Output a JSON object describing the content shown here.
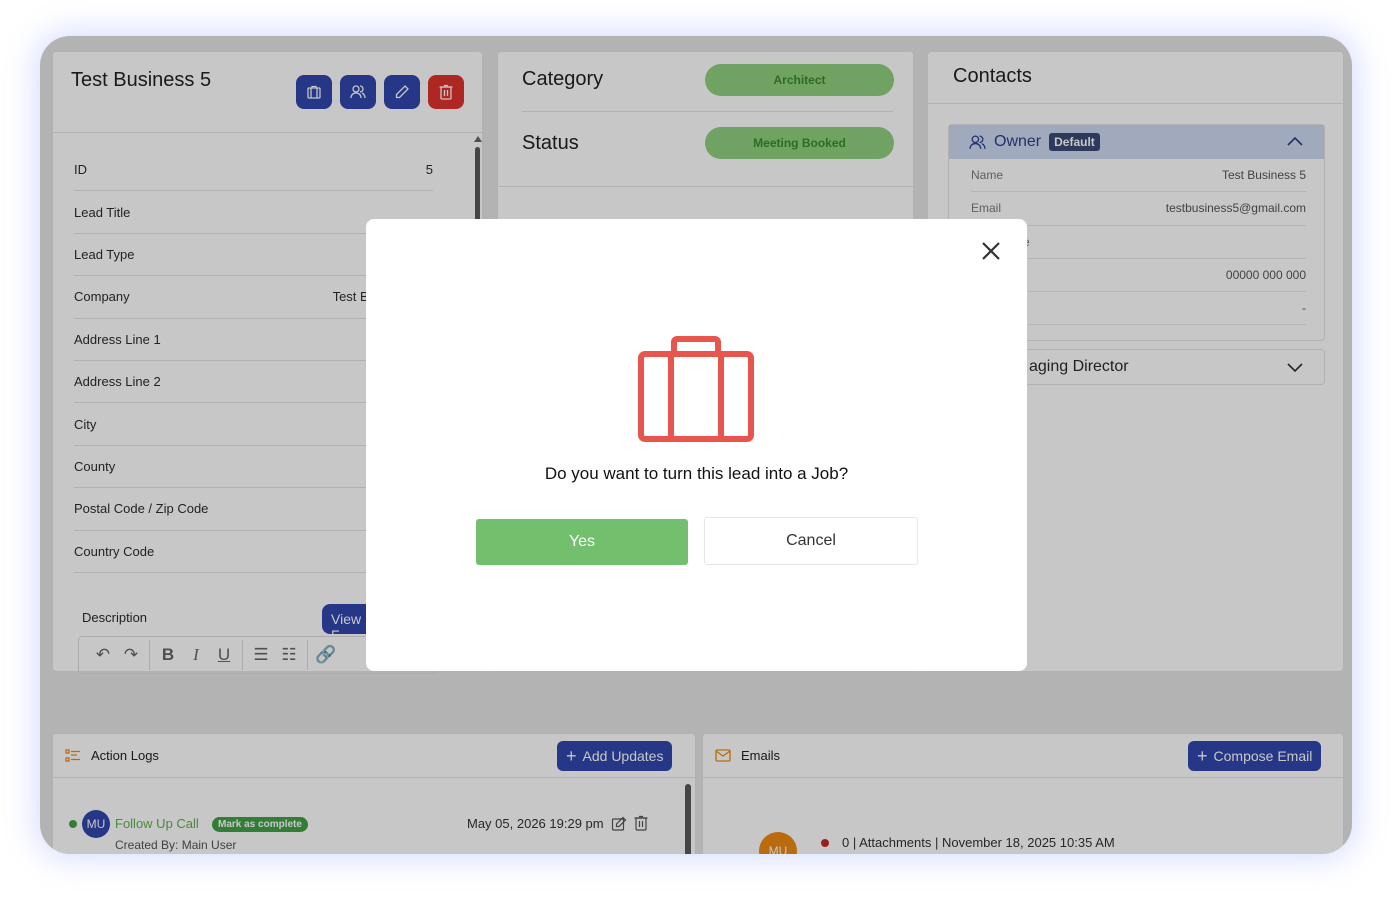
{
  "lead": {
    "title": "Test Business 5",
    "actions": [
      {
        "name": "convert-to-job-button",
        "icon": "briefcase-icon"
      },
      {
        "name": "assign-user-button",
        "icon": "users-icon"
      },
      {
        "name": "edit-button",
        "icon": "pencil-icon"
      },
      {
        "name": "delete-button",
        "icon": "trash-icon"
      }
    ],
    "fields": [
      {
        "label": "ID",
        "value": "5"
      },
      {
        "label": "Lead Title",
        "value": ""
      },
      {
        "label": "Lead Type",
        "value": ""
      },
      {
        "label": "Company",
        "value": "Test Business Co"
      },
      {
        "label": "Address Line 1",
        "value": ""
      },
      {
        "label": "Address Line 2",
        "value": ""
      },
      {
        "label": "City",
        "value": ""
      },
      {
        "label": "County",
        "value": ""
      },
      {
        "label": "Postal Code / Zip Code",
        "value": ""
      },
      {
        "label": "Country Code",
        "value": ""
      }
    ],
    "description_label": "Description",
    "view_button": "View F"
  },
  "status_panel": {
    "category_label": "Category",
    "category_value": "Architect",
    "status_label": "Status",
    "status_value": "Meeting Booked",
    "pill_color": "#8fd07f"
  },
  "contacts": {
    "title": "Contacts",
    "owner": {
      "label": "Owner",
      "badge": "Default",
      "rows": [
        {
          "key": "Name",
          "value": "Test Business 5"
        },
        {
          "key": "Email",
          "value": "testbusiness5@gmail.com"
        },
        {
          "key": "e",
          "value": ""
        },
        {
          "key": "",
          "value": "00000 000 000"
        },
        {
          "key": "",
          "value": "-"
        }
      ]
    },
    "second_contact": "aging Director"
  },
  "action_logs": {
    "title": "Action Logs",
    "add_button": "Add Updates",
    "item": {
      "avatar": "MU",
      "title": "Follow Up Call",
      "badge": "Mark as complete",
      "date": "May 05, 2026 19:29 pm",
      "created_by": "Created By: Main User"
    }
  },
  "emails": {
    "title": "Emails",
    "compose_button": "Compose Email",
    "item": {
      "avatar": "MU",
      "line": "0 | Attachments | November 18, 2025 10:35 AM"
    }
  },
  "modal": {
    "question": "Do you want to turn this lead into a Job?",
    "yes": "Yes",
    "cancel": "Cancel",
    "icon": "briefcase-icon",
    "icon_color": "#e8554d"
  },
  "colors": {
    "primary": "#3147ae",
    "danger": "#e0322c",
    "success": "#72c06e"
  }
}
